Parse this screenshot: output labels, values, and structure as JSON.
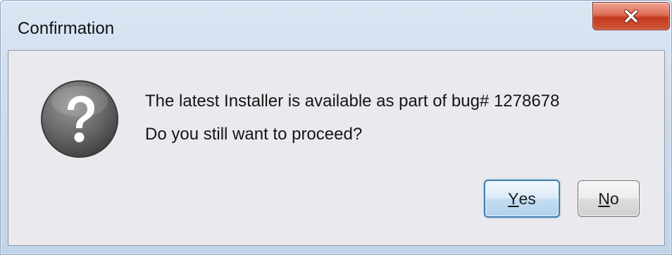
{
  "window": {
    "title": "Confirmation"
  },
  "icons": {
    "question": "question-icon",
    "close": "close-icon"
  },
  "message": {
    "line1": "The latest Installer is available as part of bug# 1278678",
    "line2": "Do you still want to proceed?"
  },
  "buttons": {
    "yes": {
      "mnemonic": "Y",
      "rest": "es"
    },
    "no": {
      "mnemonic": "N",
      "rest": "o"
    }
  },
  "colors": {
    "close_button": "#c2391d",
    "default_button_border": "#3c7fb1",
    "dialog_background": "#e9e9ee"
  }
}
